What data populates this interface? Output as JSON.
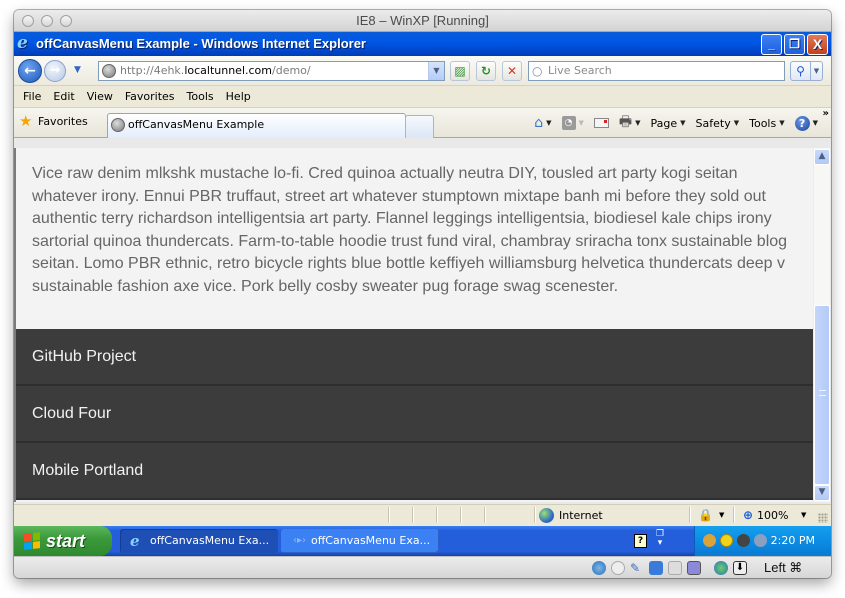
{
  "vm_window": {
    "title": "IE8 – WinXP [Running]"
  },
  "ie_window": {
    "title": "offCanvasMenu Example - Windows Internet Explorer",
    "controls": {
      "minimize": "_",
      "restore": "❐",
      "close": "X"
    }
  },
  "address_bar": {
    "url_prefix": "http://4ehk.",
    "url_host": "localtunnel.com",
    "url_path": "/demo/",
    "search_placeholder": "Live Search",
    "icons": {
      "back": "←",
      "forward": "→",
      "dropdown": "▼",
      "compatibility": "⌘",
      "refresh": "↻",
      "stop": "✕",
      "search": "⚲"
    }
  },
  "menu_bar": {
    "items": [
      "File",
      "Edit",
      "View",
      "Favorites",
      "Tools",
      "Help"
    ]
  },
  "favorites_bar": {
    "favorites_label": "Favorites",
    "tabs": [
      {
        "label": "offCanvasMenu Example",
        "active": true
      }
    ],
    "command_bar": {
      "page": "Page",
      "safety": "Safety",
      "tools": "Tools",
      "more": "»",
      "caret": "▼"
    }
  },
  "page": {
    "paragraph": "Vice raw denim mlkshk mustache lo-fi. Cred quinoa actually neutra DIY, tousled art party kogi seitan whatever irony. Ennui PBR truffaut, street art whatever stumptown mixtape banh mi before they sold out authentic terry richardson intelligentsia art party. Flannel leggings intelligentsia, biodiesel kale chips irony sartorial quinoa thundercats. Farm-to-table hoodie trust fund viral, chambray sriracha tonx sustainable blog seitan. Lomo PBR ethnic, retro bicycle rights blue bottle keffiyeh williamsburg helvetica thundercats deep v sustainable fashion axe vice. Pork belly cosby sweater pug forage swag scenester.",
    "menu_links": [
      "GitHub Project",
      "Cloud Four",
      "Mobile Portland"
    ],
    "colors": {
      "menu_bg": "#3c3c3c",
      "page_bg": "#f3f3f3",
      "text": "#666666"
    }
  },
  "scrollbar": {
    "up": "▲",
    "down": "▼"
  },
  "status_bar": {
    "zone": "Internet",
    "zoom": "100%",
    "caret": "▼"
  },
  "taskbar": {
    "start_label": "start",
    "items": [
      {
        "label": "offCanvasMenu Exa...",
        "active": true
      },
      {
        "label": "offCanvasMenu Exa...",
        "active": false
      }
    ],
    "help_icon": "?",
    "clock": "2:20 PM"
  },
  "vbox_bar": {
    "host_key": "Left ⌘"
  }
}
